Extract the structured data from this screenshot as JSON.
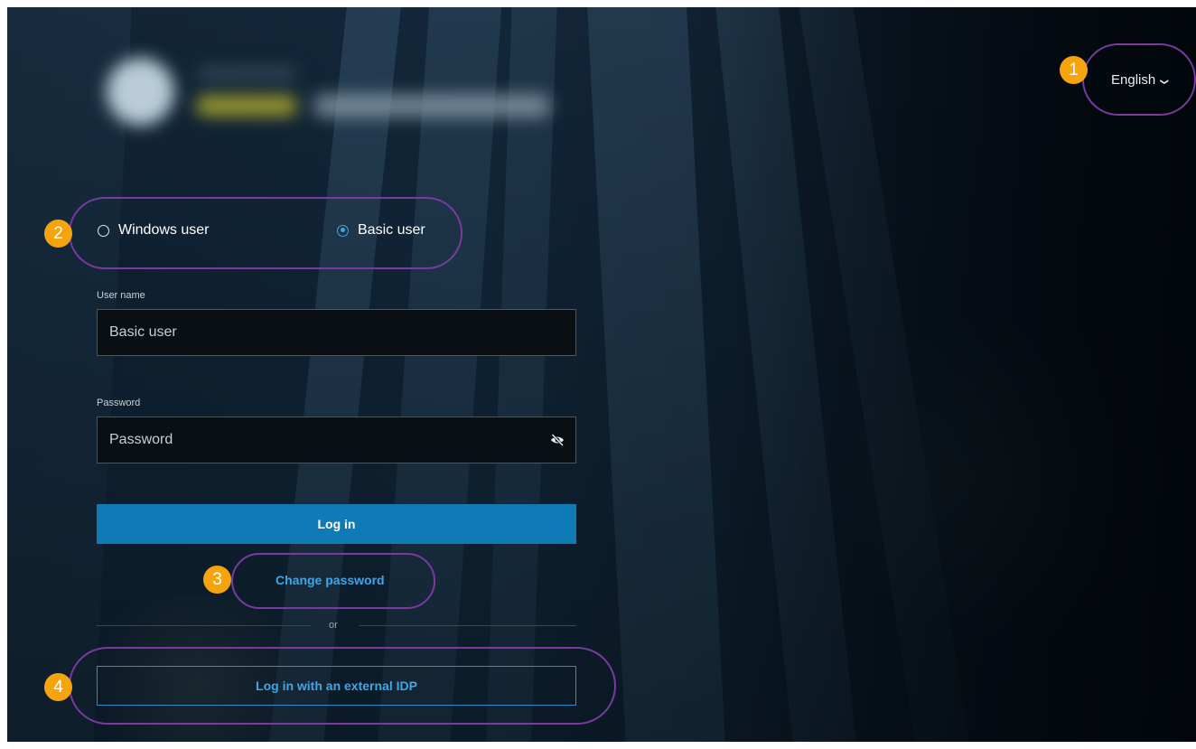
{
  "language": {
    "label": "English",
    "chevron_icon": "chevron-down-icon"
  },
  "auth_type": {
    "options": [
      {
        "label": "Windows user",
        "selected": false
      },
      {
        "label": "Basic user",
        "selected": true
      }
    ]
  },
  "username": {
    "label": "User name",
    "value": "Basic user"
  },
  "password": {
    "label": "Password",
    "placeholder": "Password",
    "toggle_icon": "eye-off-icon"
  },
  "actions": {
    "login": "Log in",
    "change_password": "Change password",
    "separator": "or",
    "external_idp": "Log in with an external IDP"
  },
  "annotations": [
    "1",
    "2",
    "3",
    "4"
  ],
  "colors": {
    "accent": "#0f7ab5",
    "link": "#3fa6e8",
    "callout_border": "#7a3aa0",
    "badge": "#f5a40d"
  }
}
